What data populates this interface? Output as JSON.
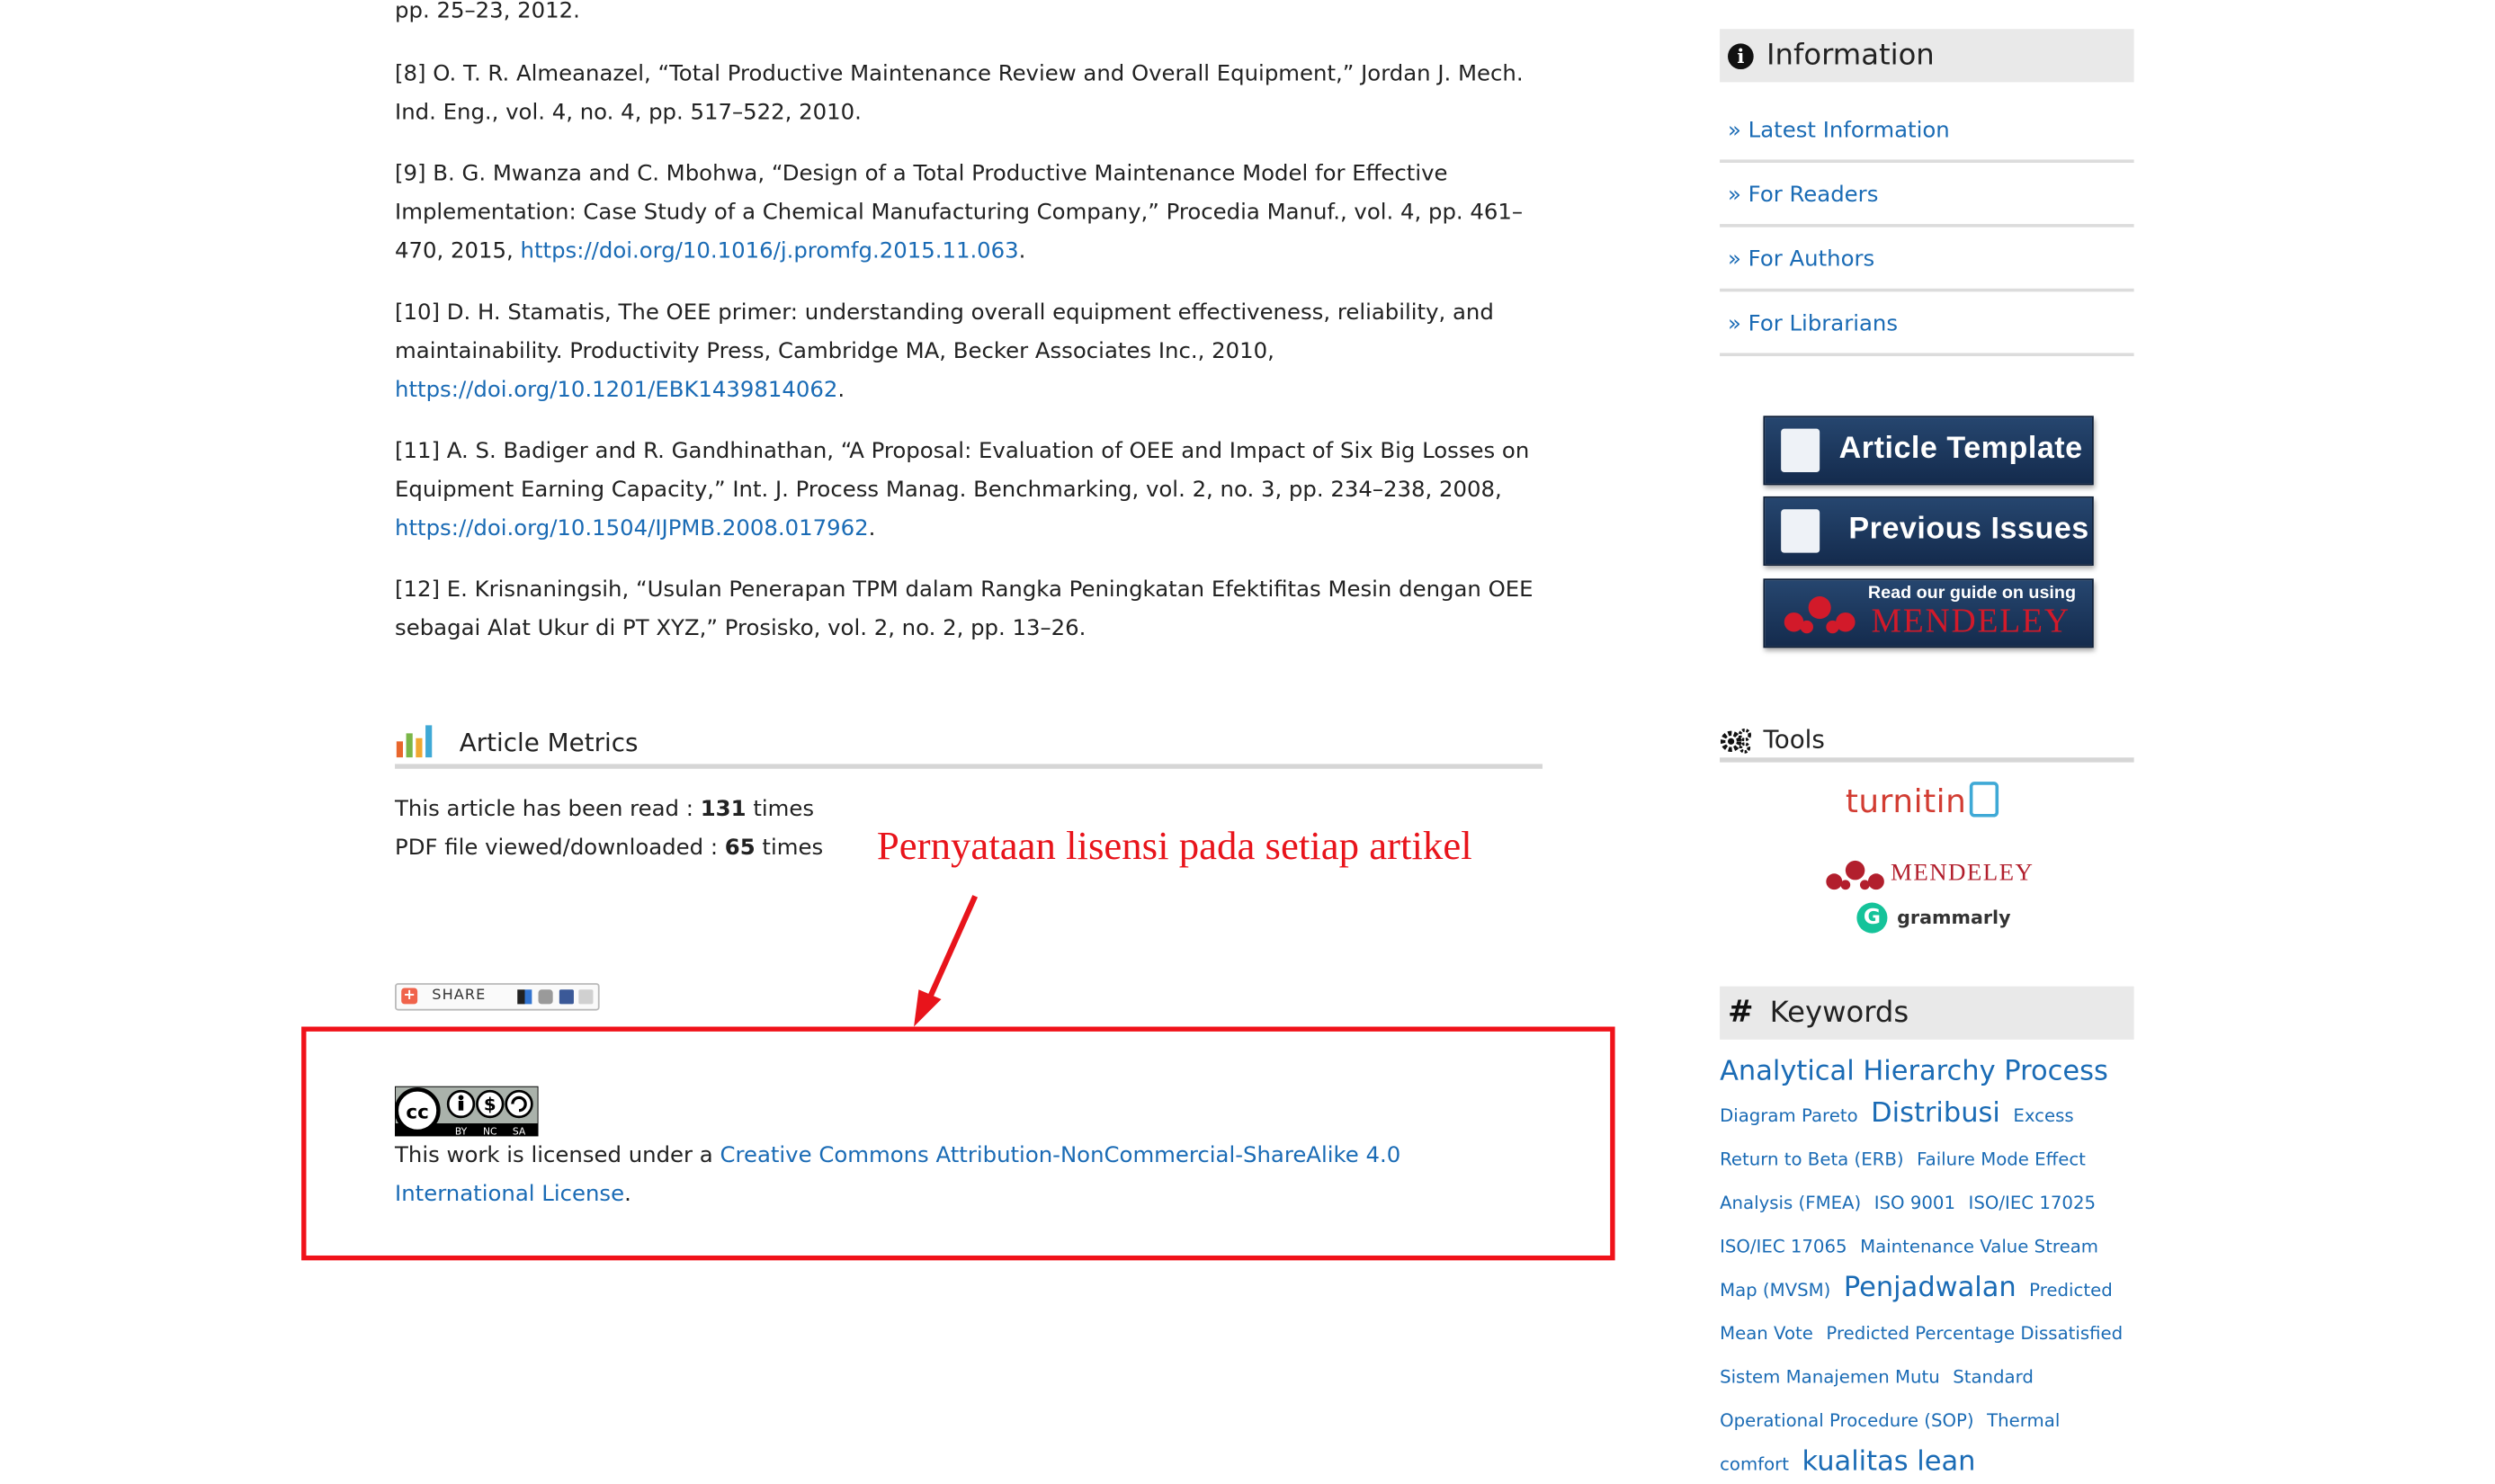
{
  "references": [
    {
      "lead": "pp. 25–23, 2012."
    },
    {
      "lead": "[8] O. T. R. Almeanazel, “Total Productive Maintenance Review and Overall Equipment,” Jordan J. Mech. Ind. Eng., vol. 4, no. 4, pp. 517–522, 2010."
    },
    {
      "lead": "[9] B. G. Mwanza and C. Mbohwa, “Design of a Total Productive Maintenance Model for Effective Implementation: Case Study of a Chemical Manufacturing Company,” Procedia Manuf., vol. 4, pp. 461–470, 2015,",
      "doi": "https://doi.org/10.1016/j.promfg.2015.11.063"
    },
    {
      "lead": "[10] D. H. Stamatis, The OEE primer: understanding overall equipment effectiveness, reliability, and maintainability. Productivity Press, Cambridge MA, Becker Associates Inc., 2010,",
      "doi": "https://doi.org/10.1201/EBK1439814062"
    },
    {
      "lead": "[11] A. S. Badiger and R. Gandhinathan, “A Proposal: Evaluation of OEE and Impact of Six Big Losses on Equipment Earning Capacity,” Int. J. Process Manag. Benchmarking, vol. 2, no. 3, pp. 234–238, 2008,",
      "doi": "https://doi.org/10.1504/IJPMB.2008.017962"
    },
    {
      "lead": "[12] E. Krisnaningsih, “Usulan Penerapan TPM dalam Rangka Peningkatan Efektifitas Mesin dengan OEE sebagai Alat Ukur di PT XYZ,” Prosisko, vol. 2, no. 2, pp. 13–26."
    }
  ],
  "ref_end": ".",
  "metrics": {
    "title": "Article Metrics",
    "read_prefix": "This article has been read : ",
    "read_count": "131",
    "read_suffix": " times",
    "pdf_prefix": "PDF file viewed/downloaded : ",
    "pdf_count": "65",
    "pdf_suffix": " times"
  },
  "annotation": "Pernyataan lisensi pada setiap artikel",
  "share_label": "SHARE",
  "cc_badge": {
    "by": "BY",
    "nc": "NC",
    "sa": "SA"
  },
  "license": {
    "prefix": "This work is licensed under a ",
    "link": "Creative Commons Attribution-NonCommercial-ShareAlike 4.0 International License",
    "suffix": "."
  },
  "sidebar": {
    "info_title": "Information",
    "info_icon": "info-icon",
    "links": [
      "» Latest Information",
      "» For Readers",
      "» For Authors",
      "» For Librarians"
    ],
    "banners": {
      "article_template": "Article Template",
      "previous_issues": "Previous Issues",
      "mendeley_small": "Read our guide on using",
      "mendeley_big": "MENDELEY"
    },
    "tools_title": "Tools",
    "tools": {
      "turnitin": "turnitin",
      "mendeley": "MENDELEY",
      "grammarly": "grammarly"
    },
    "keywords_title": "Keywords",
    "keywords": [
      {
        "text": "Analytical Hierarchy Process",
        "size": "l"
      },
      {
        "text": "Diagram Pareto",
        "size": "s"
      },
      {
        "text": "Distribusi",
        "size": "l"
      },
      {
        "text": "Excess Return to Beta (ERB)",
        "size": "s"
      },
      {
        "text": "Failure Mode Effect Analysis (FMEA)",
        "size": "s"
      },
      {
        "text": "ISO 9001",
        "size": "s"
      },
      {
        "text": "ISO/IEC 17025",
        "size": "s"
      },
      {
        "text": "ISO/IEC 17065",
        "size": "s"
      },
      {
        "text": "Maintenance Value Stream Map (MVSM)",
        "size": "s"
      },
      {
        "text": "Penjadwalan",
        "size": "l"
      },
      {
        "text": "Predicted Mean Vote",
        "size": "s"
      },
      {
        "text": "Predicted Percentage Dissatisfied",
        "size": "s"
      },
      {
        "text": "Sistem Manajemen Mutu",
        "size": "s"
      },
      {
        "text": "Standard Operational Procedure (SOP)",
        "size": "s"
      },
      {
        "text": "Thermal comfort",
        "size": "s"
      },
      {
        "text": "kualitas lean",
        "size": "l"
      }
    ]
  },
  "colors": {
    "link": "#1a6bb5",
    "annotation_red": "#e8141b",
    "box_red": "#f0121a"
  }
}
